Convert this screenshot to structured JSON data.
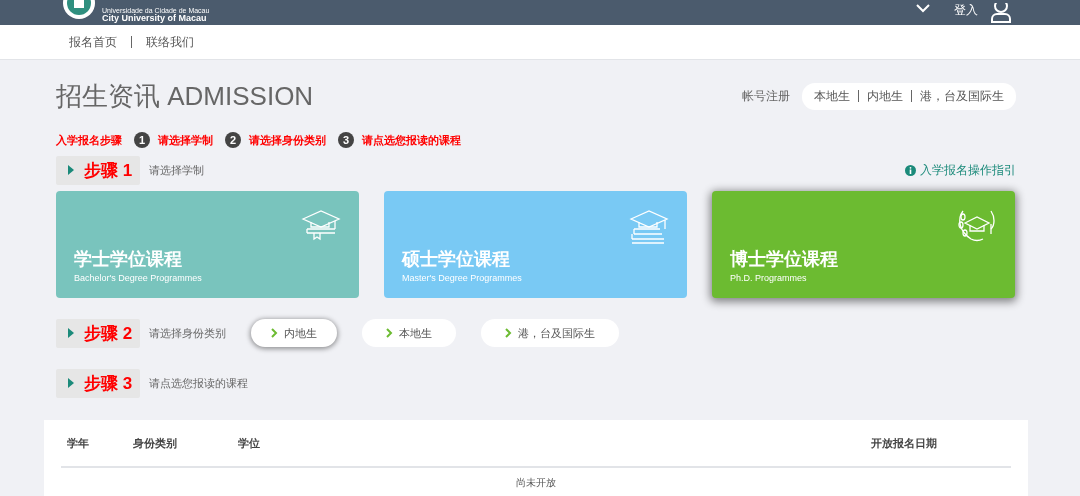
{
  "header": {
    "logo_lines": [
      "Universidade da Cidade de Macau",
      "City University of Macau"
    ],
    "login": "登入"
  },
  "nav": [
    "报名首页",
    "联络我们"
  ],
  "title": "招生资讯 ADMISSION",
  "register": {
    "label": "帐号注册",
    "links": [
      "本地生",
      "内地生",
      "港，台及国际生"
    ]
  },
  "steps_summary": {
    "label": "入学报名步骤",
    "steps": [
      {
        "number": "1",
        "text": "请选择学制"
      },
      {
        "number": "2",
        "text": "请选择身份类别"
      },
      {
        "number": "3",
        "text": "请点选您报读的课程"
      }
    ]
  },
  "guide_link": "入学报名操作指引",
  "step1": {
    "label": "步骤 1",
    "hint": "请选择学制"
  },
  "degrees": [
    {
      "title": "学士学位课程",
      "subtitle": "Bachelor's Degree Programmes",
      "color": "#79c4bd",
      "kind": "bachelor",
      "selected": false
    },
    {
      "title": "硕士学位课程",
      "subtitle": "Master's Degree Programmes",
      "color": "#79c9f4",
      "kind": "master",
      "selected": false
    },
    {
      "title": "博士学位课程",
      "subtitle": "Ph.D. Programmes",
      "color": "#6cbb31",
      "kind": "phd",
      "selected": true
    }
  ],
  "step2": {
    "label": "步骤 2",
    "hint": "请选择身份类别"
  },
  "identities": [
    {
      "label": "内地生",
      "selected": true
    },
    {
      "label": "本地生",
      "selected": false
    },
    {
      "label": "港，台及国际生",
      "selected": false
    }
  ],
  "step3": {
    "label": "步骤 3",
    "hint": "请点选您报读的课程"
  },
  "table": {
    "columns": [
      "学年",
      "身份类别",
      "学位",
      "开放报名日期"
    ],
    "empty": "尚未开放"
  }
}
